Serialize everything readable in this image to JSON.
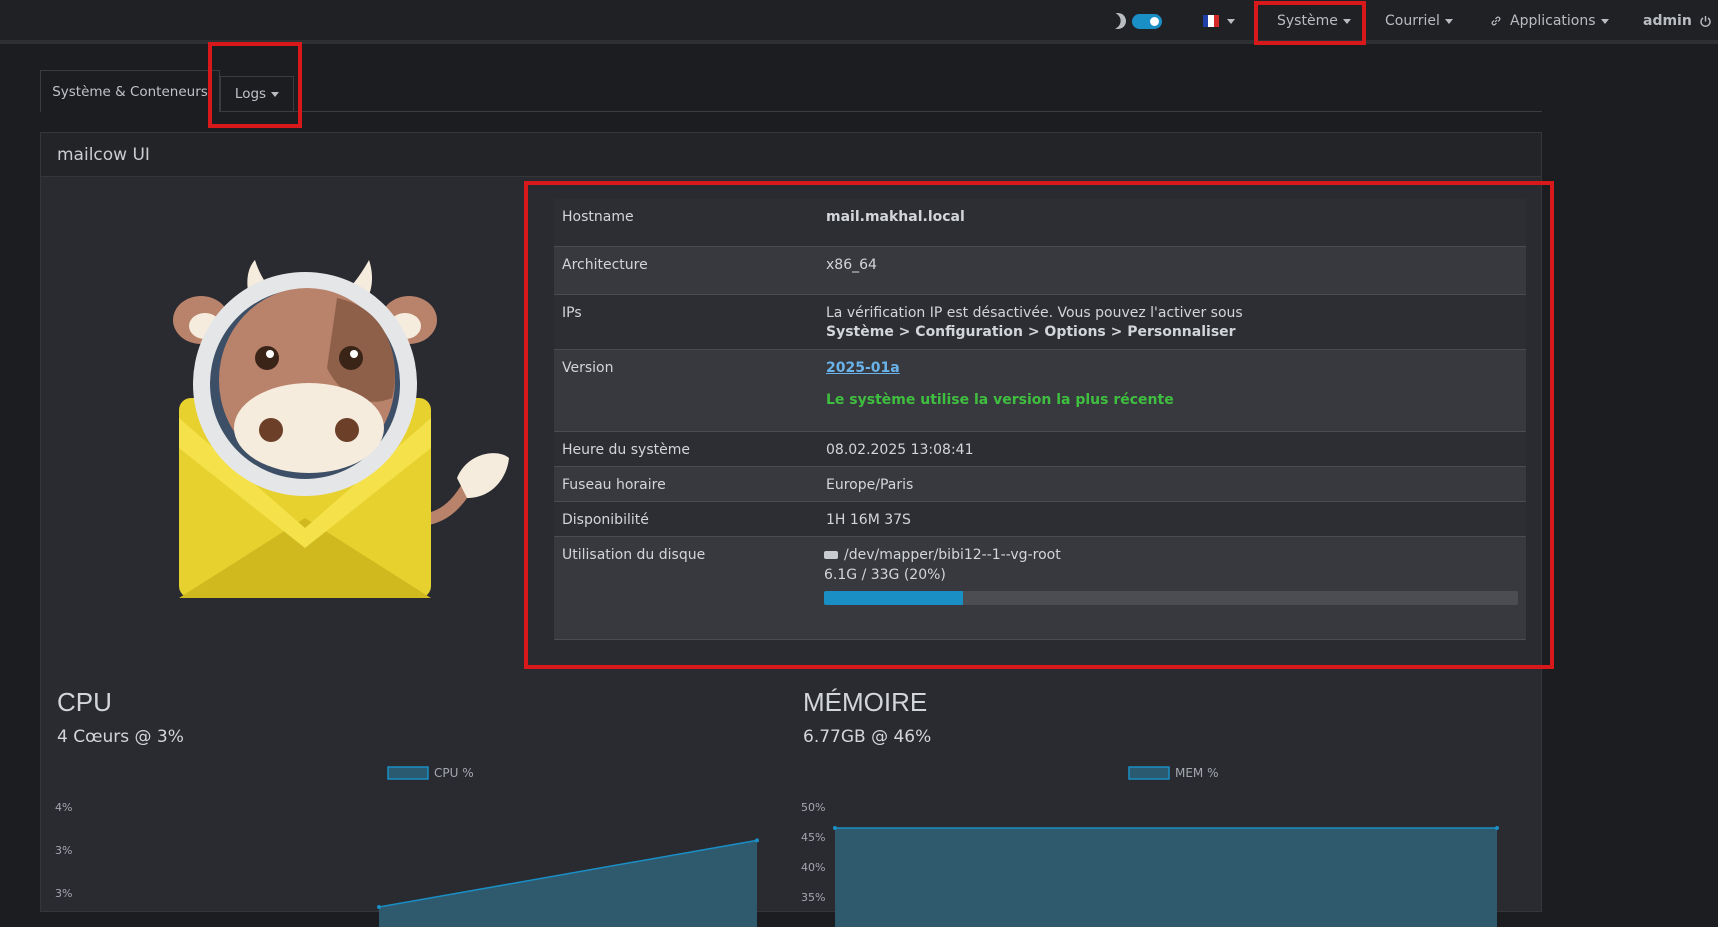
{
  "nav": {
    "systeme": "Système",
    "courriel": "Courriel",
    "applications": "Applications",
    "user": "admin"
  },
  "tabs": {
    "active": "Système & Conteneurs",
    "logs": "Logs"
  },
  "panel": {
    "title": "mailcow UI"
  },
  "info": {
    "hostname_label": "Hostname",
    "hostname_value": "mail.makhal.local",
    "arch_label": "Architecture",
    "arch_value": "x86_64",
    "ips_label": "IPs",
    "ips_text": "La vérification IP est désactivée. Vous pouvez l'activer sous",
    "ips_path": "Système > Configuration > Options > Personnaliser",
    "version_label": "Version",
    "version_value": "2025-01a",
    "version_status": "Le système utilise la version la plus récente",
    "time_label": "Heure du système",
    "time_value": "08.02.2025 13:08:41",
    "tz_label": "Fuseau horaire",
    "tz_value": "Europe/Paris",
    "uptime_label": "Disponibilité",
    "uptime_value": "1H 16M 37S",
    "disk_label": "Utilisation du disque",
    "disk_device": "/dev/mapper/bibi12--1--vg-root",
    "disk_usage": "6.1G / 33G (20%)",
    "disk_percent": 20
  },
  "colors": {
    "accent": "#1a8fc6",
    "ok": "#3fbf3f",
    "link": "#6ab3ea",
    "highlight": "#d8191c"
  },
  "cpu": {
    "title": "CPU",
    "subtitle": "4 Cœurs @ 3%"
  },
  "mem": {
    "title": "MÉMOIRE",
    "subtitle": "6.77GB @ 46%"
  },
  "chart_data": [
    {
      "type": "area",
      "legend": [
        "CPU %"
      ],
      "series": [
        {
          "name": "CPU %",
          "values": [
            2.2,
            3.4
          ]
        }
      ],
      "ytick_labels": [
        "4%",
        "3%",
        "3%"
      ],
      "ylim": [
        2.2,
        4.0
      ]
    },
    {
      "type": "area",
      "legend": [
        "MEM %"
      ],
      "series": [
        {
          "name": "MEM %",
          "values": [
            46.5,
            46.5
          ]
        }
      ],
      "ytick_labels": [
        "50%",
        "45%",
        "40%",
        "35%"
      ],
      "ylim": [
        30,
        50
      ]
    }
  ]
}
